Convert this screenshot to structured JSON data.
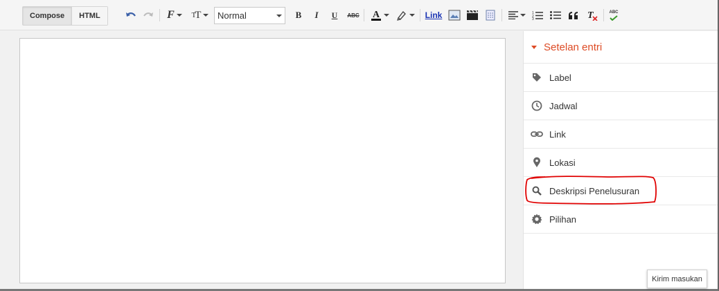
{
  "toolbar": {
    "compose_label": "Compose",
    "html_label": "HTML",
    "format_value": "Normal",
    "link_label": "Link",
    "bold_label": "B",
    "italic_label": "I",
    "underline_label": "U",
    "strike_label": "ABC",
    "spell_label": "ABC"
  },
  "sidebar": {
    "title": "Setelan entri",
    "items": [
      {
        "label": "Label",
        "icon": "tag-icon"
      },
      {
        "label": "Jadwal",
        "icon": "clock-icon"
      },
      {
        "label": "Link",
        "icon": "link-icon"
      },
      {
        "label": "Lokasi",
        "icon": "location-pin-icon"
      },
      {
        "label": "Deskripsi Penelusuran",
        "icon": "search-icon"
      },
      {
        "label": "Pilihan",
        "icon": "gear-icon"
      }
    ]
  },
  "feedback_label": "Kirim masukan",
  "colors": {
    "accent": "#dd4b25",
    "link": "#1a33b3",
    "annotation": "#e00000",
    "icon": "#555555"
  }
}
